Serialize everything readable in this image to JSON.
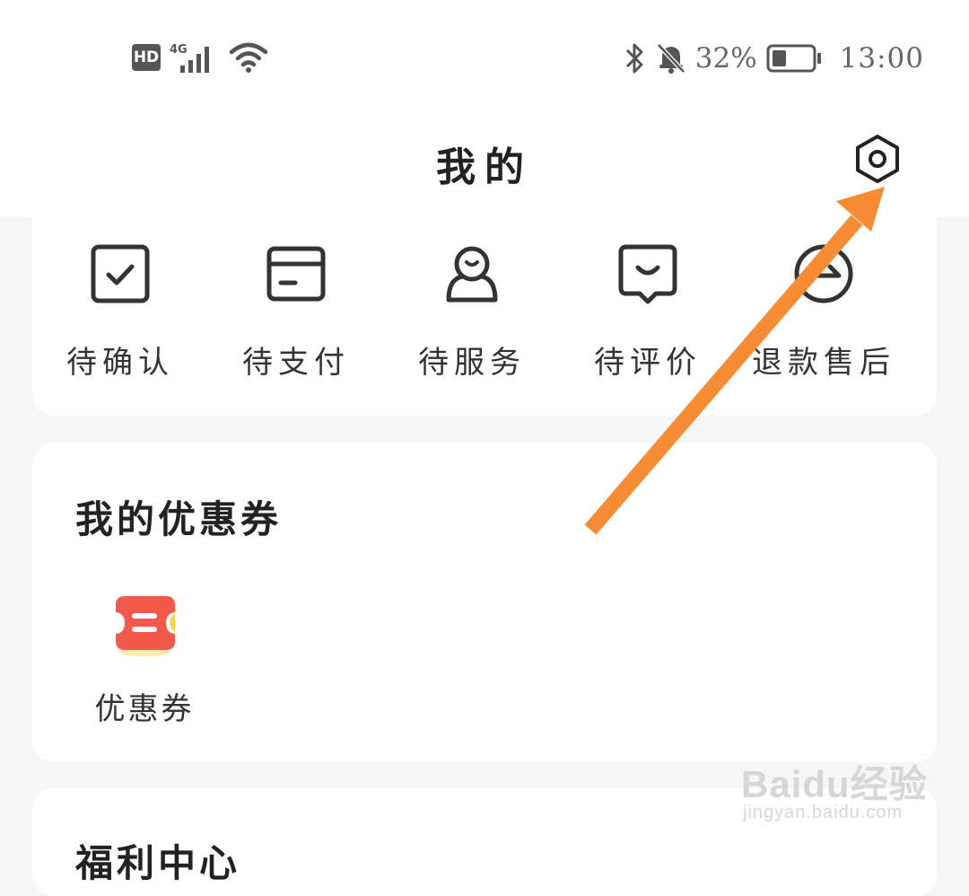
{
  "status_bar": {
    "hd": "HD",
    "network": "4G",
    "battery_percent": "32%",
    "time": "13:00",
    "icons": [
      "hd-icon",
      "signal-icon",
      "wifi-icon",
      "bluetooth-icon",
      "bell-off-icon",
      "battery-icon"
    ]
  },
  "header": {
    "title": "我的",
    "settings_icon": "gear-icon"
  },
  "orders": {
    "items": [
      {
        "label": "待确认",
        "icon": "checkbox-icon"
      },
      {
        "label": "待支付",
        "icon": "card-icon"
      },
      {
        "label": "待服务",
        "icon": "person-icon"
      },
      {
        "label": "待评价",
        "icon": "comment-icon"
      },
      {
        "label": "退款售后",
        "icon": "refund-icon"
      }
    ]
  },
  "coupons": {
    "title": "我的优惠券",
    "entry_label": "优惠券",
    "icon": "coupon-icon"
  },
  "bottom_section": {
    "title": "福利中心"
  },
  "watermark": {
    "brand": "Baidu经验",
    "url": "jingyan.baidu.com"
  },
  "colors": {
    "arrow": "#f78c34",
    "coupon_red": "#f35a4c",
    "coupon_yellow": "#ffd24d",
    "page_bg": "#f6f6f6"
  }
}
